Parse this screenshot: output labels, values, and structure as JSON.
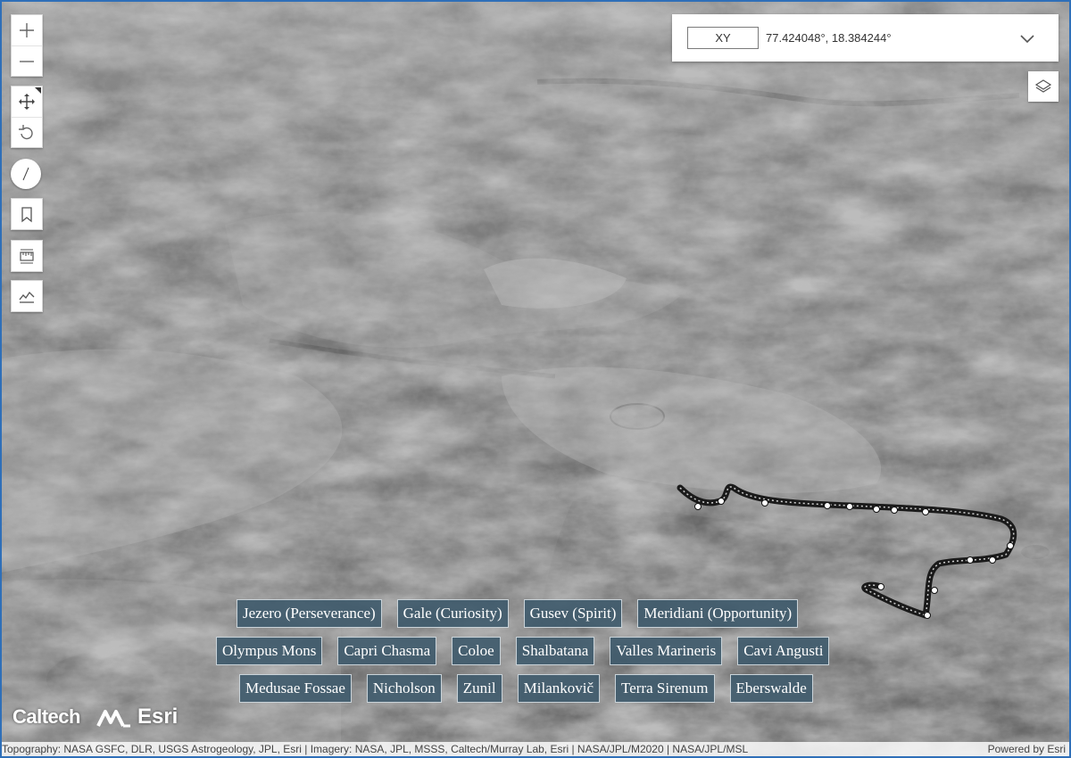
{
  "coordinate_widget": {
    "format": "XY",
    "value": "77.424048°, 18.384244°",
    "expand_icon": "chevron-down-icon"
  },
  "toolbar": {
    "zoom_in_icon": "plus-icon",
    "zoom_out_icon": "minus-icon",
    "pan_icon": "pan-move-icon",
    "rotate_icon": "rotate-icon",
    "compass_icon": "compass-icon",
    "bookmarks_icon": "bookmark-icon",
    "measure_icon": "measure-icon",
    "elevation_profile_icon": "elevation-profile-icon",
    "layers_icon": "layers-icon"
  },
  "locations": {
    "row1": [
      "Jezero (Perseverance)",
      "Gale (Curiosity)",
      "Gusev (Spirit)",
      "Meridiani (Opportunity)"
    ],
    "row2": [
      "Olympus Mons",
      "Capri Chasma",
      "Coloe",
      "Shalbatana",
      "Valles Marineris",
      "Cavi Angusti"
    ],
    "row3": [
      "Medusae Fossae",
      "Nicholson",
      "Zunil",
      "Milankovič",
      "Terra Sirenum",
      "Eberswalde"
    ]
  },
  "logos": {
    "caltech": "Caltech",
    "esri": "Esri"
  },
  "attribution": {
    "text": "Topography: NASA GSFC, DLR, USGS Astrogeology, JPL, Esri | Imagery: NASA, JPL, MSSS, Caltech/Murray Lab, Esri | NASA/JPL/M2020 | NASA/JPL/MSL",
    "powered_by": "Powered by Esri"
  },
  "colors": {
    "location_button_bg": "#3e5a6c",
    "rover_track": "#1a1a1a",
    "waypoint": "#ffffff"
  }
}
